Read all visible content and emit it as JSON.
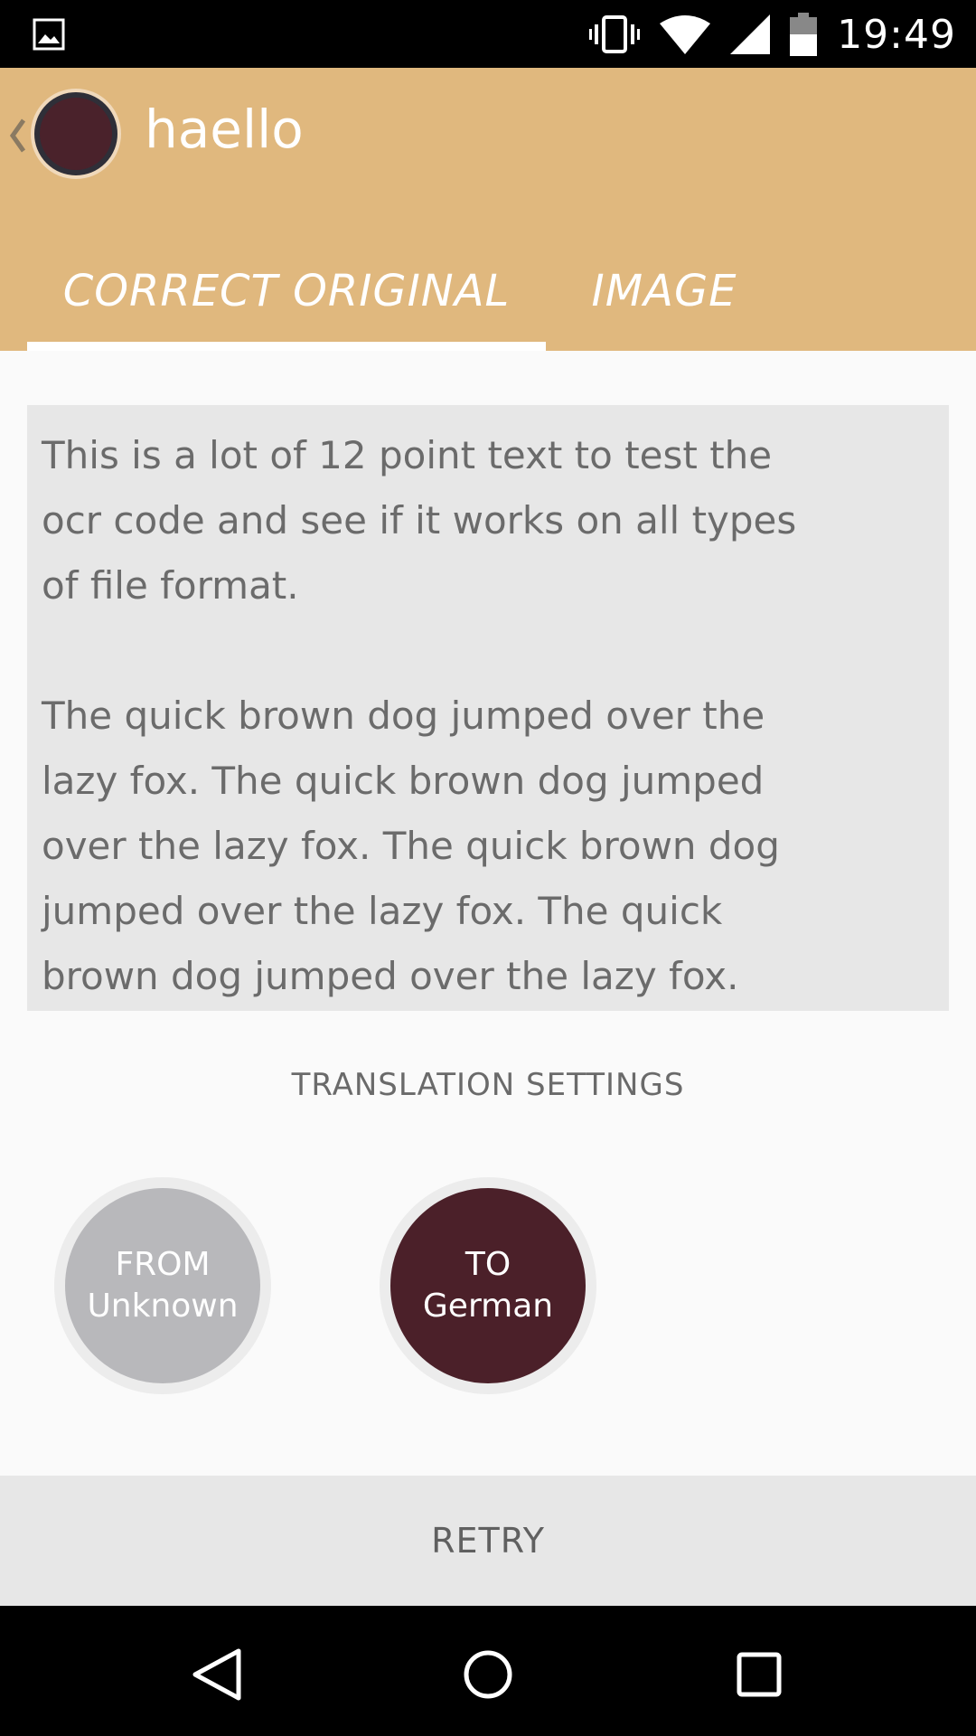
{
  "status_bar": {
    "time": "19:49",
    "icons": [
      "image-icon",
      "vibrate-icon",
      "wifi-icon",
      "signal-icon",
      "battery-icon"
    ]
  },
  "app_bar": {
    "title": "haello",
    "back_icon": "chevron-left-icon",
    "avatar_color": "#4a222b",
    "background": "#e0b87e"
  },
  "tabs": [
    {
      "label": "CORRECT ORIGINAL",
      "selected": true
    },
    {
      "label": "IMAGE",
      "selected": false
    }
  ],
  "ocr_text": "This is a lot of 12 point text to test the\nocr code and see if it works on all types\nof file format.\n\nThe quick brown dog jumped over the\nlazy fox. The quick brown dog jumped\nover the lazy fox. The quick brown dog\njumped over the lazy fox. The quick\nbrown dog jumped over the lazy fox.",
  "translation_settings": {
    "heading": "TRANSLATION SETTINGS",
    "from": {
      "label": "FROM",
      "value": "Unknown",
      "color": "#b8b8bb"
    },
    "to": {
      "label": "TO",
      "value": "German",
      "color": "#4b2029"
    }
  },
  "retry_label": "RETRY",
  "nav_bar": {
    "icons": [
      "back-triangle-icon",
      "home-circle-icon",
      "recents-square-icon"
    ]
  }
}
